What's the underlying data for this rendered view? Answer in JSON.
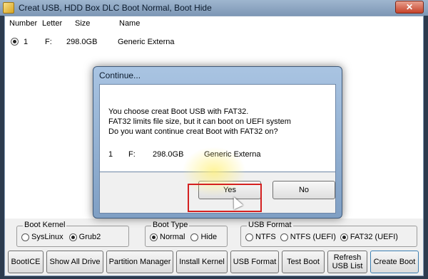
{
  "window": {
    "title": "Creat USB, HDD Box DLC Boot Normal, Boot Hide",
    "close_glyph": "✕"
  },
  "list": {
    "headers": {
      "number": "Number",
      "letter": "Letter",
      "size": "Size",
      "name": "Name"
    },
    "rows": [
      {
        "number": "1",
        "letter": "F:",
        "size": "298.0GB",
        "name": "Generic Externa"
      }
    ]
  },
  "boot_kernel": {
    "title": "Boot Kernel",
    "options": [
      "SysLinux",
      "Grub2"
    ],
    "selected": "Grub2"
  },
  "boot_type": {
    "title": "Boot Type",
    "options": [
      "Normal",
      "Hide"
    ],
    "selected": "Normal"
  },
  "usb_format": {
    "title": "USB Format",
    "options": [
      "NTFS",
      "NTFS (UEFI)",
      "FAT32 (UEFI)"
    ],
    "selected": "FAT32 (UEFI)"
  },
  "buttons": {
    "bootice": "BootICE",
    "show_all_drive": "Show All Drive",
    "partition_manager": "Partition Manager",
    "install_kernel": "Install Kernel",
    "usb_format": "USB Format",
    "test_boot": "Test Boot",
    "refresh_line1": "Refresh",
    "refresh_line2": "USB List",
    "create_boot": "Create Boot"
  },
  "dialog": {
    "title": "Continue...",
    "line1": "You choose creat Boot USB with FAT32.",
    "line2": "FAT32 limits file size, but it can boot on UEFI system",
    "line3": "Do you want continue creat Boot with FAT32 on?",
    "drive": {
      "number": "1",
      "letter": "F:",
      "size": "298.0GB",
      "name": "Generic Externa"
    },
    "yes": "Yes",
    "no": "No"
  },
  "colors": {
    "titlebar": "#8aa3c0",
    "focus_highlight": "#d42020"
  }
}
